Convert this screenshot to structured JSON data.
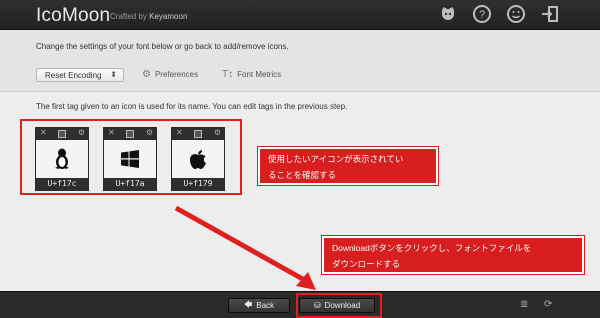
{
  "header": {
    "logo": "IcoMoon",
    "crafted_prefix": "Crafted by",
    "crafted_author": "Keyamoon",
    "icons": [
      "github-icon",
      "help-icon",
      "smiley-icon",
      "exit-icon"
    ]
  },
  "settings": {
    "intro": "Change the settings of your font below or go back to add/remove icons.",
    "select_value": "Reset Encoding",
    "preferences": "Preferences",
    "font_metrics": "Font Metrics"
  },
  "main": {
    "tag_notice": "The first tag given to an icon is used for its name. You can edit tags in the previous step.",
    "glyphs": [
      {
        "icon": "linux-icon",
        "code": "U+f17c"
      },
      {
        "icon": "windows-icon",
        "code": "U+f17a"
      },
      {
        "icon": "apple-icon",
        "code": "U+f179"
      }
    ],
    "callout1": [
      "使用したいアイコンが表示されてい",
      "ることを確認する"
    ],
    "callout2": [
      "Downloadボタンをクリックし、フォントファイルを",
      "ダウンロードする"
    ]
  },
  "footer": {
    "back": "Back",
    "download": "Download"
  },
  "colors": {
    "accent_red": "#e02020",
    "header_bg": "#2a2a2a"
  }
}
